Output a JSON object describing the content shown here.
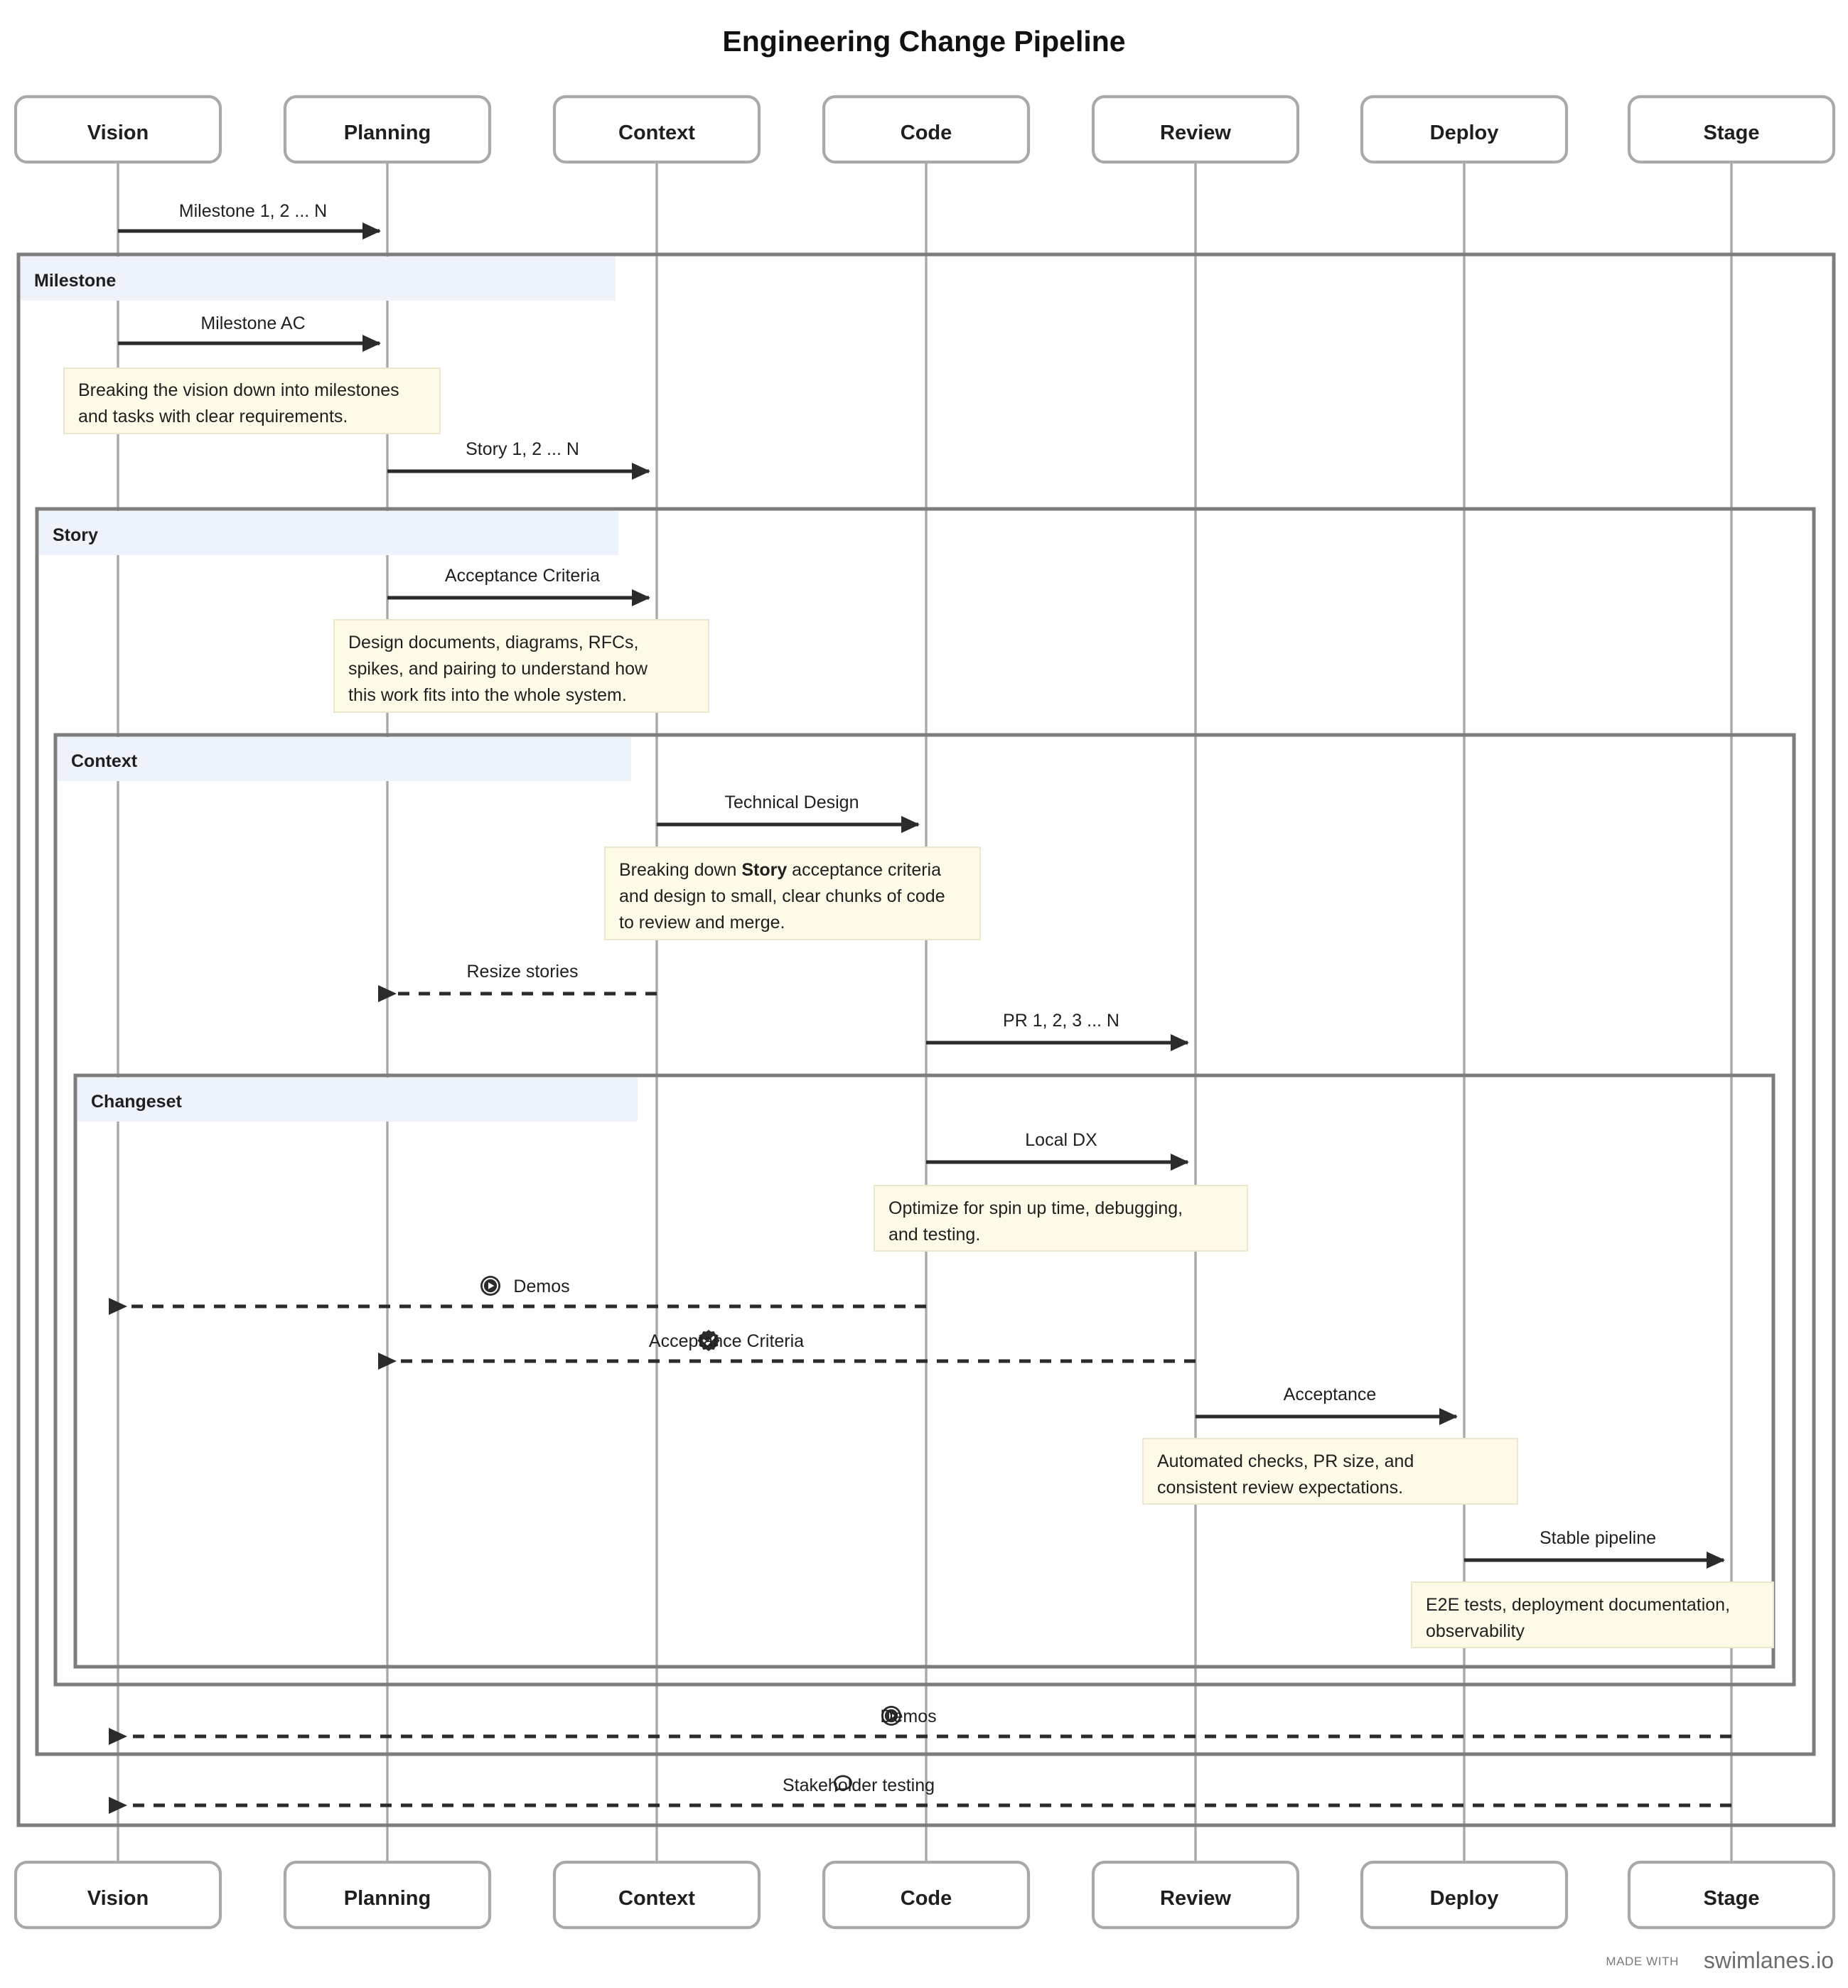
{
  "diagram": {
    "title": "Engineering Change Pipeline",
    "type": "sequence-diagram",
    "watermark": {
      "prefix": "MADE WITH",
      "brand": "swimlanes.io"
    },
    "colors": {
      "fragment_tab": "#eef2fb",
      "fragment_border": "#7d7d7d",
      "note_fill": "#fdfbe8",
      "actor_border": "#a9a9a9",
      "message": "#2b2b2b",
      "background": "#ffffff"
    },
    "actors": [
      {
        "id": "vision",
        "label": "Vision"
      },
      {
        "id": "planning",
        "label": "Planning"
      },
      {
        "id": "context",
        "label": "Context"
      },
      {
        "id": "code",
        "label": "Code"
      },
      {
        "id": "review",
        "label": "Review"
      },
      {
        "id": "deploy",
        "label": "Deploy"
      },
      {
        "id": "stage",
        "label": "Stage"
      }
    ],
    "fragments": [
      {
        "id": "milestone",
        "label": "Milestone"
      },
      {
        "id": "story",
        "label": "Story"
      },
      {
        "id": "context",
        "label": "Context"
      },
      {
        "id": "changeset",
        "label": "Changeset"
      }
    ],
    "messages": [
      {
        "id": "m1",
        "label": "Milestone 1, 2 ... N",
        "from": "vision",
        "to": "planning",
        "style": "solid",
        "icon": ""
      },
      {
        "id": "m2",
        "label": "Milestone AC",
        "from": "vision",
        "to": "planning",
        "style": "solid",
        "icon": ""
      },
      {
        "id": "m3",
        "label": "Story 1, 2 ... N",
        "from": "planning",
        "to": "context",
        "style": "solid",
        "icon": ""
      },
      {
        "id": "m4",
        "label": "Acceptance Criteria",
        "from": "planning",
        "to": "context",
        "style": "solid",
        "icon": ""
      },
      {
        "id": "m5",
        "label": "Technical Design",
        "from": "context",
        "to": "code",
        "style": "solid",
        "icon": ""
      },
      {
        "id": "m6",
        "label": "Resize stories",
        "from": "context",
        "to": "planning",
        "style": "dashed",
        "icon": ""
      },
      {
        "id": "m7",
        "label": "PR 1, 2, 3 ... N",
        "from": "code",
        "to": "review",
        "style": "solid",
        "icon": ""
      },
      {
        "id": "m8",
        "label": "Local DX",
        "from": "code",
        "to": "review",
        "style": "solid",
        "icon": ""
      },
      {
        "id": "m9",
        "label": "Demos",
        "from": "code",
        "to": "vision",
        "style": "dashed",
        "icon": "play-circle-icon"
      },
      {
        "id": "m10",
        "label": "Acceptance Criteria",
        "from": "review",
        "to": "planning",
        "style": "dashed",
        "icon": "badge-check-icon"
      },
      {
        "id": "m11",
        "label": "Acceptance",
        "from": "review",
        "to": "deploy",
        "style": "solid",
        "icon": ""
      },
      {
        "id": "m12",
        "label": "Stable pipeline",
        "from": "deploy",
        "to": "stage",
        "style": "solid",
        "icon": ""
      },
      {
        "id": "m13",
        "label": "Demos",
        "from": "stage",
        "to": "vision",
        "style": "dashed",
        "icon": "play-circle-icon"
      },
      {
        "id": "m14",
        "label": "Stakeholder testing",
        "from": "stage",
        "to": "vision",
        "style": "dashed",
        "icon": "comment-icon"
      }
    ],
    "notes": [
      {
        "id": "n1",
        "lines": [
          {
            "text": "Breaking the vision down into milestones"
          },
          {
            "text": "and tasks with clear requirements."
          }
        ]
      },
      {
        "id": "n2",
        "lines": [
          {
            "text": "Design documents, diagrams, RFCs,"
          },
          {
            "text": "spikes, and pairing to understand how"
          },
          {
            "text": "this work fits into the whole system."
          }
        ]
      },
      {
        "id": "n3",
        "lines": [
          {
            "text": "Breaking down "
          },
          {
            "text": "Story",
            "bold": true
          },
          {
            "text": " acceptance criteria"
          },
          {
            "text": "and design to small, clear chunks of code"
          },
          {
            "text": "to review and merge."
          }
        ]
      },
      {
        "id": "n4",
        "lines": [
          {
            "text": "Optimize for spin up time, debugging,"
          },
          {
            "text": "and testing."
          }
        ]
      },
      {
        "id": "n5",
        "lines": [
          {
            "text": "Automated checks, PR size, and"
          },
          {
            "text": "consistent review expectations."
          }
        ]
      },
      {
        "id": "n6",
        "lines": [
          {
            "text": "E2E tests, deployment documentation,"
          },
          {
            "text": "observability"
          }
        ]
      }
    ]
  }
}
